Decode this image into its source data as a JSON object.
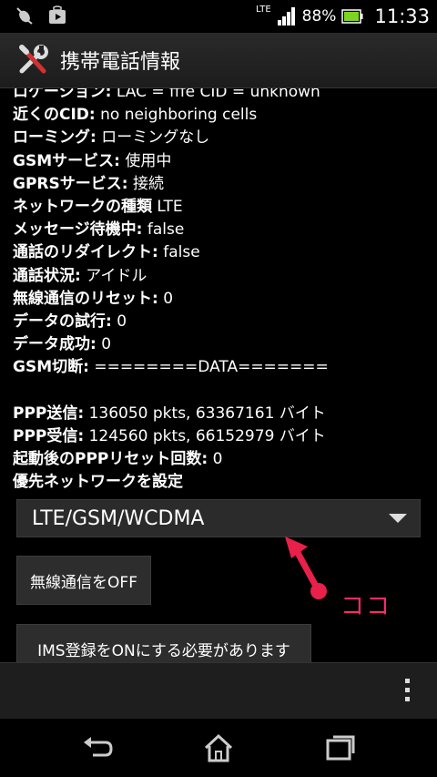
{
  "status_bar": {
    "lte": "LTE",
    "battery": "88%",
    "time": "11:33",
    "icons": [
      "bug-icon",
      "play-store-icon",
      "signal-icon",
      "battery-icon"
    ]
  },
  "action_bar": {
    "title": "携帯電話情報",
    "icon": "tools-icon"
  },
  "info": [
    {
      "label": "ロケーション:",
      "value": " LAC = fffe   CID = unknown"
    },
    {
      "label": "近くのCID:",
      "value": " no neighboring cells"
    },
    {
      "label": "ローミング:",
      "value": " ローミングなし"
    },
    {
      "label": "GSMサービス:",
      "value": " 使用中"
    },
    {
      "label": "GPRSサービス:",
      "value": " 接続"
    },
    {
      "label": "ネットワークの種類",
      "value": " LTE"
    },
    {
      "label": "メッセージ待機中:",
      "value": " false"
    },
    {
      "label": "通話のリダイレクト:",
      "value": " false"
    },
    {
      "label": "通話状況:",
      "value": " アイドル"
    },
    {
      "label": "無線通信のリセット:",
      "value": " 0"
    },
    {
      "label": "データの試行:",
      "value": " 0"
    },
    {
      "label": "データ成功:",
      "value": " 0"
    },
    {
      "label": "GSM切断:",
      "value": " ========DATA======="
    },
    {
      "label": "",
      "value": ""
    },
    {
      "label": "PPP送信:",
      "value": " 136050 pkts, 63367161 バイト"
    },
    {
      "label": "PPP受信:",
      "value": " 124560 pkts, 66152979 バイト"
    },
    {
      "label": "起動後のPPPリセット回数:",
      "value": " 0"
    },
    {
      "label": "優先ネットワークを設定",
      "value": ""
    }
  ],
  "preferred_network": {
    "selected": "LTE/GSM/WCDMA"
  },
  "buttons": {
    "radio_off": "無線通信をOFF",
    "ims": "IMS登録をONにする必要があります"
  },
  "annotation": {
    "text": "ココ",
    "color": "#ff2a6a"
  },
  "nav": {
    "icons": [
      "back-icon",
      "home-icon",
      "recent-apps-icon",
      "overflow-menu-icon"
    ]
  },
  "colors": {
    "battery": "#7ed321",
    "annotation": "#e8204a"
  }
}
